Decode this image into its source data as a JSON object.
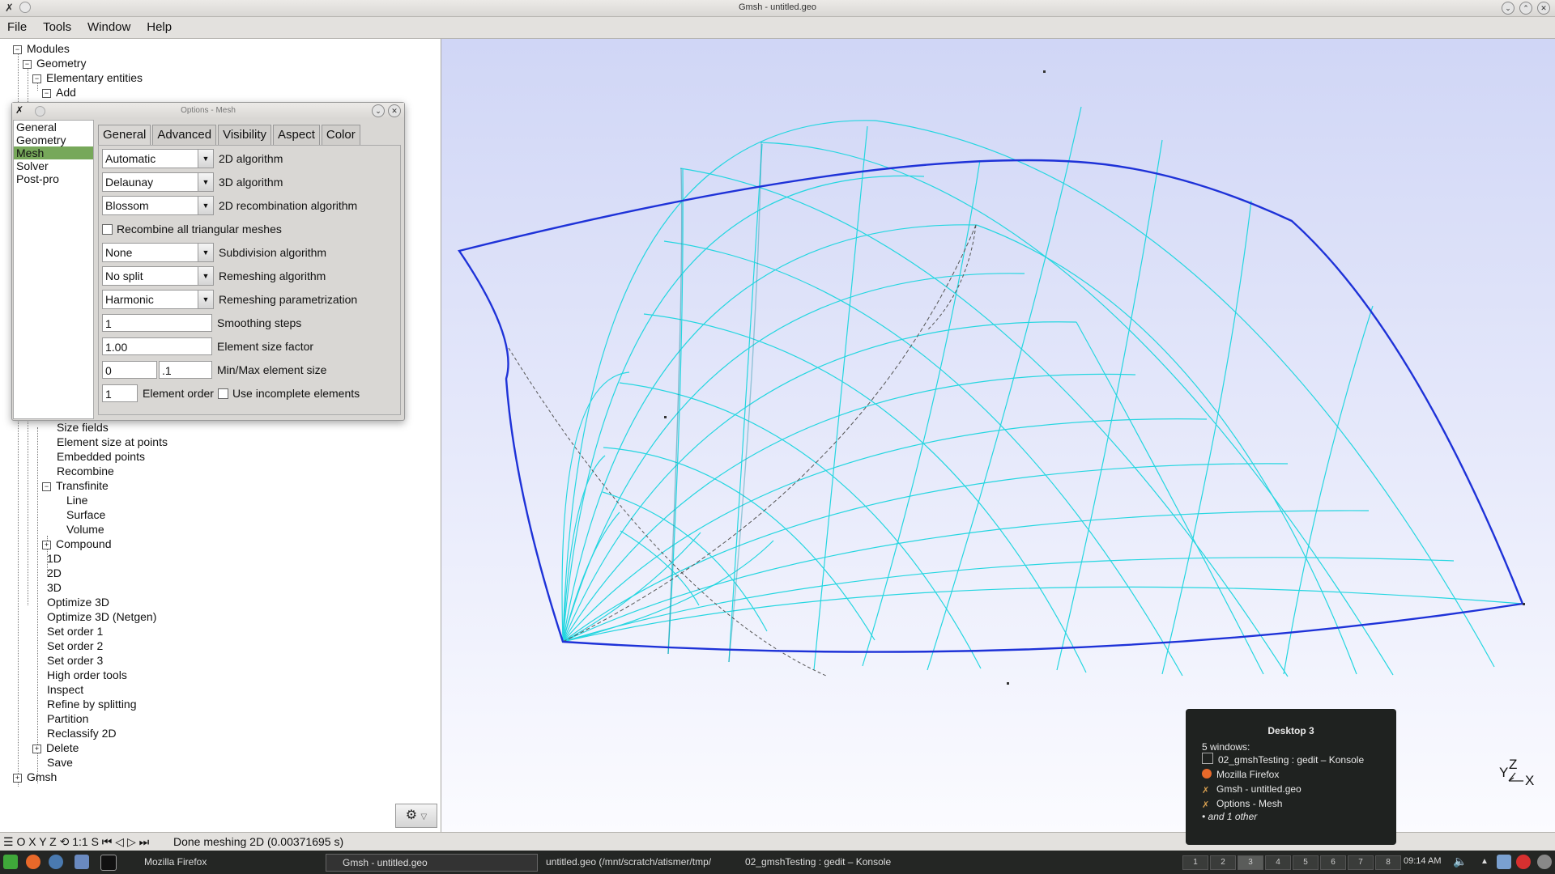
{
  "window": {
    "title": "Gmsh - untitled.geo"
  },
  "menu": [
    "File",
    "Tools",
    "Window",
    "Help"
  ],
  "tree": {
    "modules": "Modules",
    "geometry": "Geometry",
    "elementary": "Elementary entities",
    "add": "Add",
    "items": [
      "Size fields",
      "Element size at points",
      "Embedded points",
      "Recombine",
      "Transfinite",
      "Line",
      "Surface",
      "Volume",
      "Compound",
      "1D",
      "2D",
      "3D",
      "Optimize 3D",
      "Optimize 3D (Netgen)",
      "Set order 1",
      "Set order 2",
      "Set order 3",
      "High order tools",
      "Inspect",
      "Refine by splitting",
      "Partition",
      "Reclassify 2D",
      "Delete",
      "Save",
      "Gmsh"
    ]
  },
  "options": {
    "title": "Options - Mesh",
    "categories": [
      "General",
      "Geometry",
      "Mesh",
      "Solver",
      "Post-pro"
    ],
    "tabs": [
      "General",
      "Advanced",
      "Visibility",
      "Aspect",
      "Color"
    ],
    "alg2d": {
      "value": "Automatic",
      "label": "2D algorithm"
    },
    "alg3d": {
      "value": "Delaunay",
      "label": "3D algorithm"
    },
    "recomb": {
      "value": "Blossom",
      "label": "2D recombination algorithm"
    },
    "recombine_all": "Recombine all triangular meshes",
    "subdiv": {
      "value": "None",
      "label": "Subdivision algorithm"
    },
    "remesh": {
      "value": "No split",
      "label": "Remeshing algorithm"
    },
    "param": {
      "value": "Harmonic",
      "label": "Remeshing parametrization"
    },
    "smoothing": {
      "value": "1",
      "label": "Smoothing steps"
    },
    "size_factor": {
      "value": "1.00",
      "label": "Element size factor"
    },
    "minmax": {
      "min": "0",
      "max": ".1",
      "label": "Min/Max element size"
    },
    "order": {
      "value": "1",
      "label": "Element order",
      "incomplete": "Use incomplete elements"
    }
  },
  "status": {
    "controls": "☰ O X Y Z ⟲ 1:1 S ⏮ ◁ ▷ ⏭",
    "message": "Done meshing 2D (0.00371695 s)"
  },
  "axes": {
    "y": "Y",
    "z": "Z",
    "x": "X"
  },
  "desktop_popup": {
    "title": "Desktop 3",
    "count": "5 windows:",
    "items": [
      "02_gmshTesting : gedit – Konsole",
      "Mozilla Firefox",
      "Gmsh - untitled.geo",
      "Options - Mesh"
    ],
    "more": "• and 1 other"
  },
  "taskbar": {
    "tasks": [
      "Mozilla Firefox",
      "Gmsh - untitled.geo",
      "untitled.geo (/mnt/scratch/atismer/tmp/",
      "02_gmshTesting : gedit – Konsole"
    ],
    "pager": [
      "1",
      "2",
      "3",
      "4",
      "5",
      "6",
      "7",
      "8"
    ],
    "clock": "09:14 AM"
  },
  "colors": {
    "mesh": "#25d6e0",
    "boundary": "#1e32d8",
    "selected": "#77a85a"
  }
}
